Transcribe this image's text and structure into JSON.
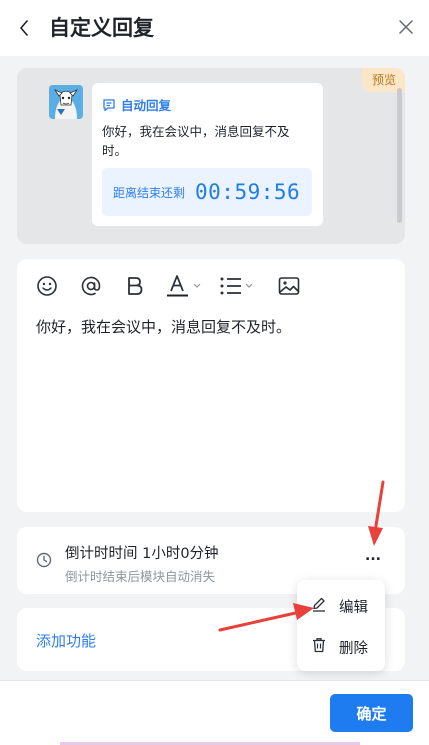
{
  "header": {
    "title": "自定义回复",
    "back_icon": "chevron-left-icon",
    "close_icon": "close-icon"
  },
  "preview": {
    "tag": "预览",
    "card": {
      "head_icon": "auto-reply-icon",
      "head_label": "自动回复",
      "message": "你好，我在会议中，消息回复不及时。",
      "countdown_label": "距离结束还剩",
      "countdown_time": "00:59:56"
    }
  },
  "editor": {
    "toolbar": [
      "emoji-icon",
      "mention-icon",
      "bold-icon",
      "font-color-icon",
      "list-icon",
      "image-icon"
    ],
    "content": "你好，我在会议中，消息回复不及时。"
  },
  "timer": {
    "title": "倒计时时间 1小时0分钟",
    "subtitle": "倒计时结束后模块自动消失",
    "more_label": "..."
  },
  "menu": {
    "items": [
      {
        "icon": "edit-icon",
        "label": "编辑"
      },
      {
        "icon": "trash-icon",
        "label": "删除"
      }
    ]
  },
  "add_function": {
    "label": "添加功能"
  },
  "footer": {
    "confirm_label": "确定"
  },
  "colors": {
    "accent": "#1e7cf0",
    "link": "#2f7ee8",
    "preview_tag_bg": "#fbe6c7",
    "annotation_arrow": "#e8403b"
  }
}
